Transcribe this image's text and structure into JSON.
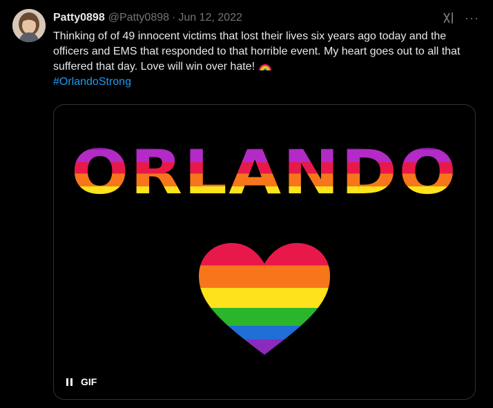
{
  "tweet": {
    "author": {
      "display_name": "Patty0898",
      "handle": "@Patty0898"
    },
    "separator": "·",
    "date": "Jun 12, 2022",
    "text": "Thinking of of 49 innocent victims that lost their lives six years ago today and the officers and EMS that responded to that horrible event. My heart goes out to all that suffered that day. Love will win over hate!",
    "emoji": "rainbow-emoji",
    "hashtag": "#OrlandoStrong",
    "more_label": "···",
    "icons": [
      "grok-icon",
      "more-icon",
      "pause-icon"
    ]
  },
  "media": {
    "type": "gif",
    "headline": "ORLANDO",
    "badge_label": "GIF",
    "shapes": [
      "rainbow-text",
      "rainbow-heart"
    ]
  },
  "colors": {
    "background": "#000000",
    "text": "#e7e9ea",
    "secondary": "#71767b",
    "link": "#1d9bf0",
    "border": "#2f3336",
    "rainbow": [
      "#7a1fa0",
      "#a32bbd",
      "#e8194a",
      "#f7761b",
      "#fde21c",
      "#2bb52b",
      "#1f6fd6"
    ]
  }
}
